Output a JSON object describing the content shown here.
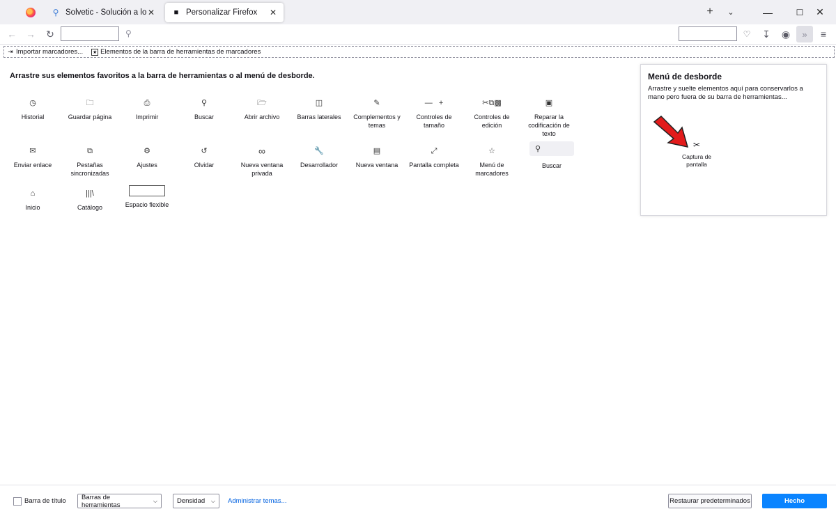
{
  "tabs": [
    {
      "title": "Solvetic - Solución a los problem",
      "icon": "search-favicon"
    },
    {
      "title": "Personalizar Firefox",
      "icon": "customize-brush-icon"
    }
  ],
  "bookmarks_bar": {
    "items": [
      "Importar marcadores...",
      "Elementos de la barra de herramientas de marcadores"
    ]
  },
  "palette": {
    "title": "Arrastre sus elementos favoritos a la barra de herramientas o al menú de desborde.",
    "items": [
      {
        "label": "Historial",
        "icon": "history-clock-icon"
      },
      {
        "label": "Guardar página",
        "icon": "save-page-icon"
      },
      {
        "label": "Imprimir",
        "icon": "print-icon"
      },
      {
        "label": "Buscar",
        "icon": "find-icon"
      },
      {
        "label": "Abrir archivo",
        "icon": "open-file-icon"
      },
      {
        "label": "Barras laterales",
        "icon": "sidebar-icon"
      },
      {
        "label": "Complementos y temas",
        "icon": "addons-puzzle-icon"
      },
      {
        "label": "Controles de tamaño",
        "icon": "zoom-controls-icon"
      },
      {
        "label": "Controles de edición",
        "icon": "edit-controls-icon"
      },
      {
        "label": "Reparar la codificación de texto",
        "icon": "text-encoding-icon"
      },
      {
        "label": "Enviar enlace",
        "icon": "email-link-icon"
      },
      {
        "label": "Pestañas sincronizadas",
        "icon": "synced-tabs-icon"
      },
      {
        "label": "Ajustes",
        "icon": "settings-gear-icon"
      },
      {
        "label": "Olvidar",
        "icon": "forget-icon"
      },
      {
        "label": "Nueva ventana privada",
        "icon": "private-window-icon"
      },
      {
        "label": "Desarrollador",
        "icon": "developer-wrench-icon"
      },
      {
        "label": "Nueva ventana",
        "icon": "new-window-icon"
      },
      {
        "label": "Pantalla completa",
        "icon": "fullscreen-icon"
      },
      {
        "label": "Menú de marcadores",
        "icon": "bookmarks-menu-icon"
      },
      {
        "label": "Buscar",
        "icon": "search-bar-icon"
      },
      {
        "label": "Inicio",
        "icon": "home-icon"
      },
      {
        "label": "Catálogo",
        "icon": "library-icon"
      },
      {
        "label": "Espacio flexible",
        "icon": "flexible-space"
      }
    ]
  },
  "overflow_panel": {
    "title": "Menú de desborde",
    "description": "Arrastre y suelte elementos aquí para conservarlos a mano pero fuera de su barra de herramientas...",
    "item_label": "Captura de pantalla",
    "item_icon": "screenshot-scissors-icon"
  },
  "footer": {
    "title_bar_label": "Barra de título",
    "toolbars_select": "Barras de herramientas",
    "density_select": "Densidad",
    "manage_themes": "Administrar temas...",
    "restore_defaults": "Restaurar predeterminados",
    "done": "Hecho"
  },
  "colors": {
    "accent": "#0a84ff",
    "link": "#0061e0",
    "arrow": "#e31b1b"
  }
}
